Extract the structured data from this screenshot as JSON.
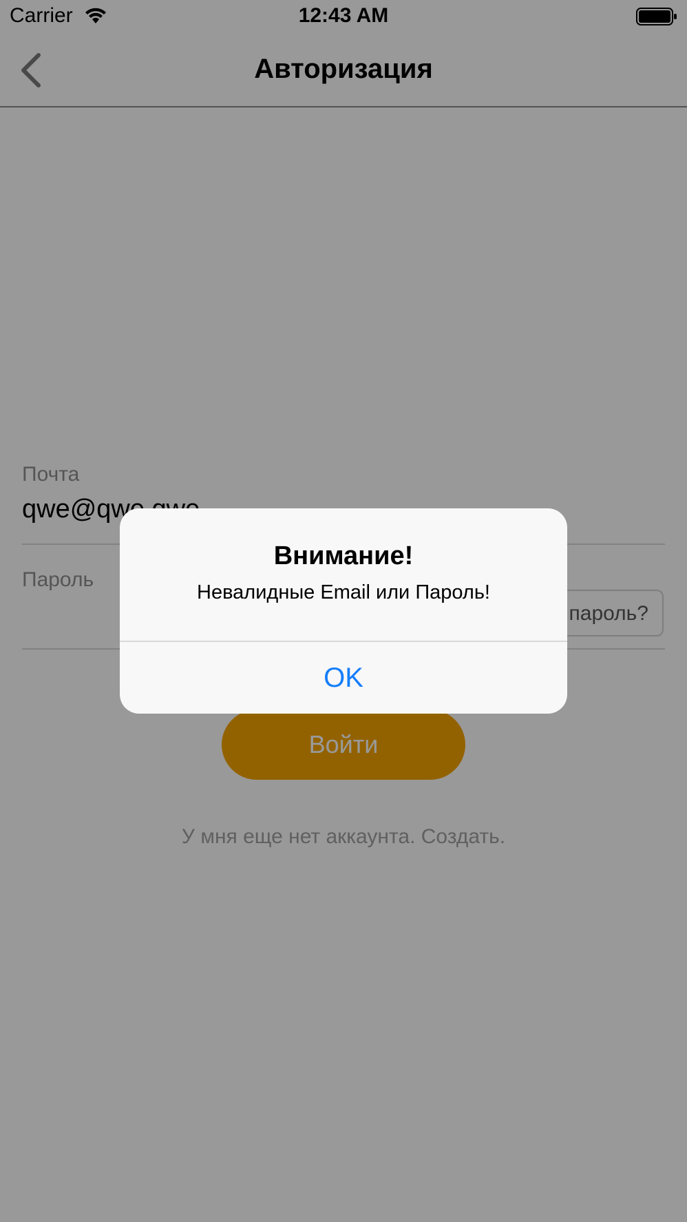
{
  "status_bar": {
    "carrier": "Carrier",
    "time": "12:43 AM",
    "wifi_icon": "wifi-icon",
    "battery_icon": "battery-icon"
  },
  "nav": {
    "title": "Авторизация",
    "back_icon": "chevron-left-icon"
  },
  "form": {
    "email_label": "Почта",
    "email_value": "qwe@qwe.qwe",
    "password_label": "Пароль",
    "forgot_label": "пароль?",
    "login_label": "Войти",
    "register_text": "У мня еще нет аккаунта. Создать."
  },
  "alert": {
    "title": "Внимание!",
    "message": "Невалидные Email или Пароль!",
    "ok_label": "OK"
  },
  "colors": {
    "accent": "#f5a400",
    "ios_blue": "#147efb"
  }
}
